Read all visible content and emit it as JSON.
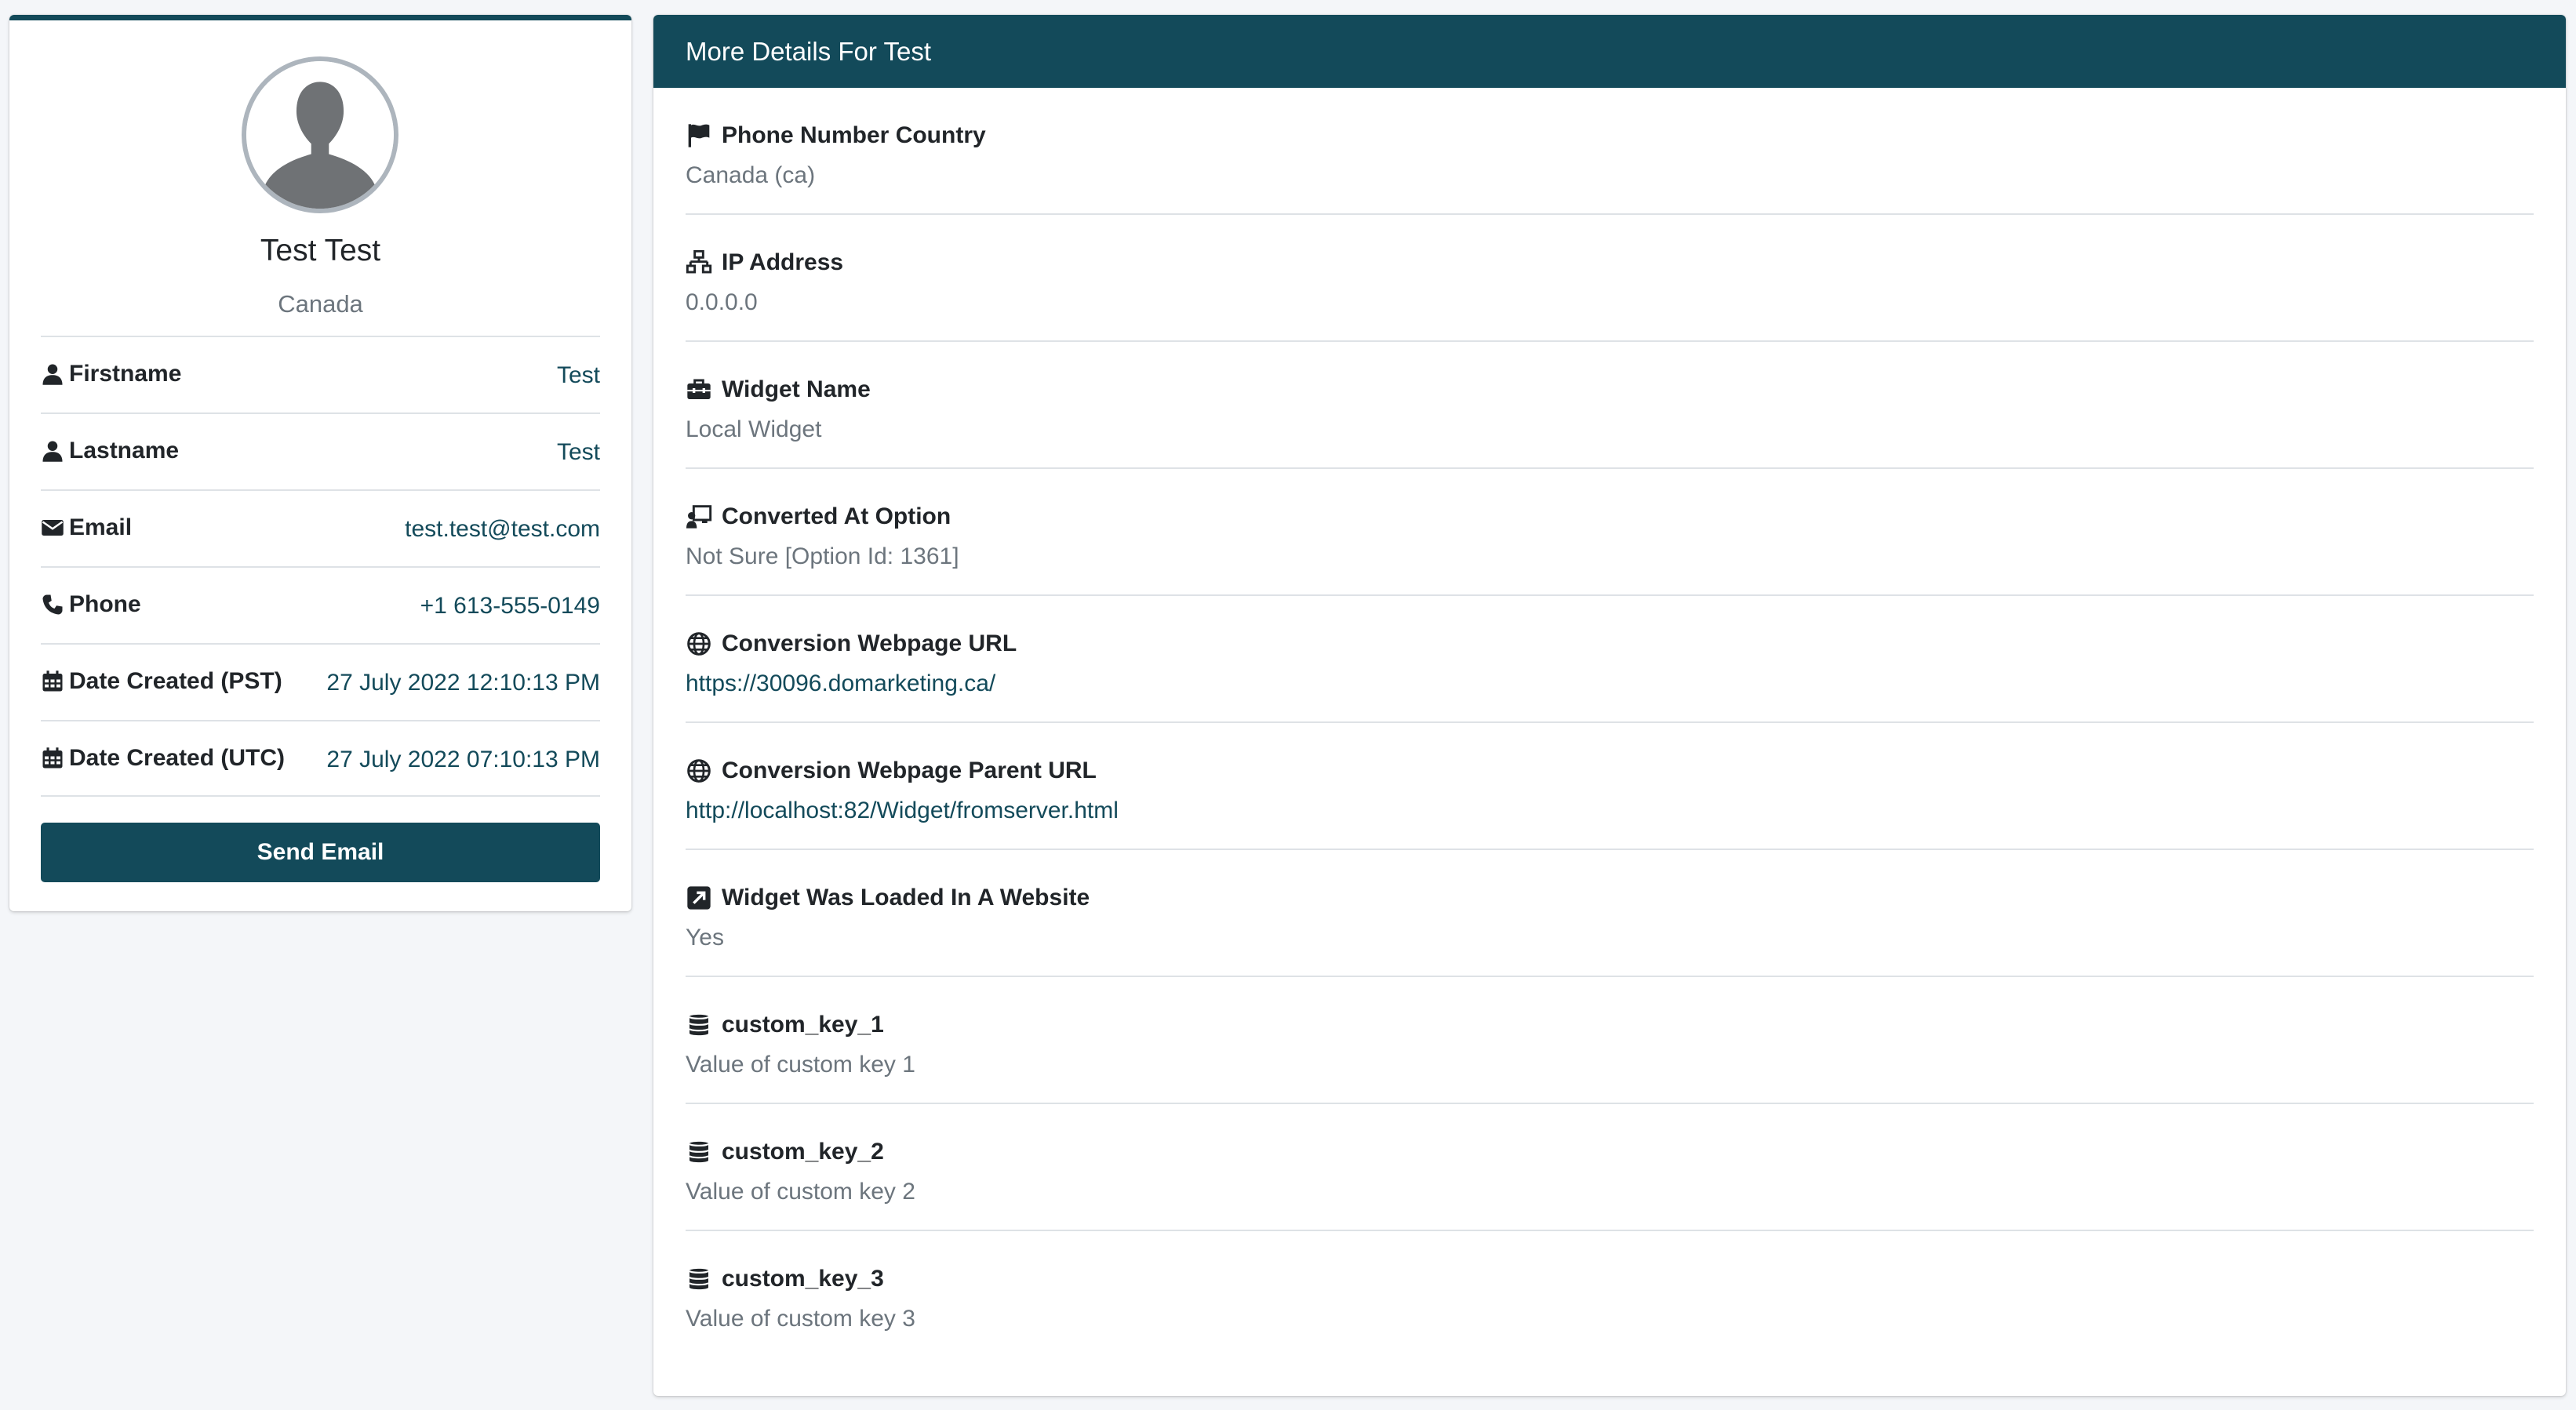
{
  "profile": {
    "name": "Test Test",
    "country": "Canada",
    "rows": [
      {
        "label": "Firstname",
        "value": "Test",
        "icon": "user-icon"
      },
      {
        "label": "Lastname",
        "value": "Test",
        "icon": "user-icon"
      },
      {
        "label": "Email",
        "value": "test.test@test.com",
        "icon": "envelope-icon"
      },
      {
        "label": "Phone",
        "value": "+1 613-555-0149",
        "icon": "phone-icon"
      },
      {
        "label": "Date Created (PST)",
        "value": "27 July 2022 12:10:13 PM",
        "icon": "calendar-icon"
      },
      {
        "label": "Date Created (UTC)",
        "value": "27 July 2022 07:10:13 PM",
        "icon": "calendar-icon"
      }
    ],
    "send_button": "Send Email"
  },
  "details": {
    "header": "More Details For Test",
    "items": [
      {
        "title": "Phone Number Country",
        "value": "Canada (ca)",
        "icon": "flag-icon"
      },
      {
        "title": "IP Address",
        "value": "0.0.0.0",
        "icon": "network-icon"
      },
      {
        "title": "Widget Name",
        "value": "Local Widget",
        "icon": "toolbox-icon"
      },
      {
        "title": "Converted At Option",
        "value": "Not Sure [Option Id: 1361]",
        "icon": "chalkboard-user-icon"
      },
      {
        "title": "Conversion Webpage URL",
        "value": "https://30096.domarketing.ca/",
        "icon": "globe-icon"
      },
      {
        "title": "Conversion Webpage Parent URL",
        "value": "http://localhost:82/Widget/fromserver.html",
        "icon": "globe-icon"
      },
      {
        "title": "Widget Was Loaded In A Website",
        "value": "Yes",
        "icon": "external-link-square-icon"
      },
      {
        "title": "custom_key_1",
        "value": "Value of custom key 1",
        "icon": "database-icon"
      },
      {
        "title": "custom_key_2",
        "value": "Value of custom key 2",
        "icon": "database-icon"
      },
      {
        "title": "custom_key_3",
        "value": "Value of custom key 3",
        "icon": "database-icon"
      }
    ]
  },
  "colors": {
    "primary": "#134a5a",
    "muted": "#6c757d",
    "background": "#f4f6f9"
  }
}
